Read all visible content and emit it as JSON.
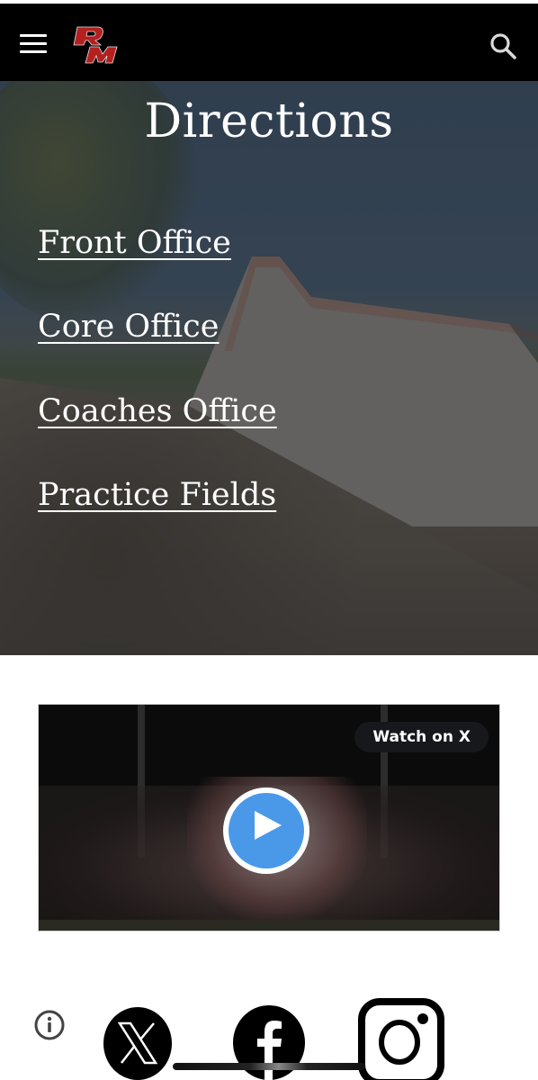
{
  "header": {
    "logo_text": "RM",
    "menu_icon": "hamburger-menu-icon",
    "search_icon": "search-icon"
  },
  "hero": {
    "title": "Directions",
    "links": [
      {
        "label": "Front Office"
      },
      {
        "label": "Core Office"
      },
      {
        "label": "Coaches Office"
      },
      {
        "label": "Practice Fields"
      }
    ]
  },
  "video": {
    "watch_label": "Watch on X",
    "play_icon": "play-icon"
  },
  "footer": {
    "info_icon": "info-icon",
    "social": [
      {
        "name": "X",
        "icon": "x-logo-icon"
      },
      {
        "name": "Facebook",
        "icon": "facebook-icon"
      },
      {
        "name": "Instagram",
        "icon": "instagram-icon"
      }
    ]
  },
  "colors": {
    "header_bg": "#000000",
    "logo_red": "#b3201f",
    "play_blue": "#4a99e9",
    "pill_bg": "#16181c"
  }
}
